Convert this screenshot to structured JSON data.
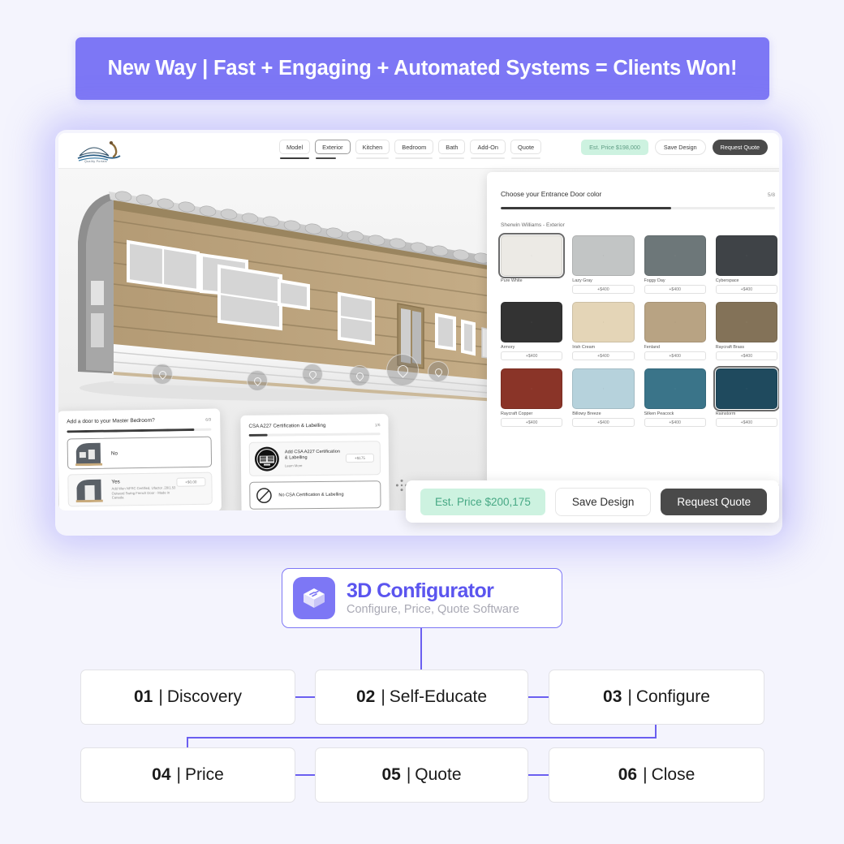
{
  "theme": {
    "page_bg": "#f4f4fd",
    "accent": "#7d77f5",
    "accent_dark": "#5b55ef",
    "price_green_bg": "#cdf2e0",
    "price_green_fg": "#46a884"
  },
  "banner": {
    "text": "New Way | Fast + Engaging + Automated Systems = Clients Won!"
  },
  "app": {
    "logo": {
      "caption": "Quality Portals"
    },
    "tabs": [
      {
        "label": "Model",
        "state": "done"
      },
      {
        "label": "Exterior",
        "state": "selected"
      },
      {
        "label": "Kitchen",
        "state": "idle"
      },
      {
        "label": "Bedroom",
        "state": "idle"
      },
      {
        "label": "Bath",
        "state": "idle"
      },
      {
        "label": "Add-On",
        "state": "idle"
      },
      {
        "label": "Quote",
        "state": "idle"
      }
    ],
    "topbar": {
      "price_label": "Est. Price $198,000",
      "save_label": "Save Design",
      "quote_label": "Request Quote"
    },
    "color_panel": {
      "title": "Choose your Entrance Door color",
      "step": "5/8",
      "progress_percent": 62,
      "brand_line": "Sherwin Williams - Exterior",
      "swatches": [
        {
          "name": "Pure White",
          "hex": "#eceae5",
          "price": "",
          "selected": true
        },
        {
          "name": "Lazy Gray",
          "hex": "#c2c5c5",
          "price": "+$400",
          "selected": false
        },
        {
          "name": "Foggy Day",
          "hex": "#6d7779",
          "price": "+$400",
          "selected": false
        },
        {
          "name": "Cyberspace",
          "hex": "#3f4347",
          "price": "+$400",
          "selected": false
        },
        {
          "name": "Armory",
          "hex": "#333333",
          "price": "+$400",
          "selected": false
        },
        {
          "name": "Irish Cream",
          "hex": "#e4d5b7",
          "price": "+$400",
          "selected": false
        },
        {
          "name": "Fenland",
          "hex": "#b8a383",
          "price": "+$400",
          "selected": false
        },
        {
          "name": "Raycraft Brass",
          "hex": "#837258",
          "price": "+$400",
          "selected": false
        },
        {
          "name": "Raycraft Copper",
          "hex": "#8a3428",
          "price": "+$400",
          "selected": false
        },
        {
          "name": "Billowy Breeze",
          "hex": "#b6d2dc",
          "price": "+$400",
          "selected": false
        },
        {
          "name": "Silken Peacock",
          "hex": "#3a7489",
          "price": "+$400",
          "selected": false
        },
        {
          "name": "Rainstorm",
          "hex": "#1f4a5e",
          "price": "+$400",
          "selected": true
        }
      ]
    },
    "door_panel": {
      "title": "Add a door to your Master Bedroom?",
      "step": "6/9",
      "progress_percent": 88,
      "options": [
        {
          "label": "No",
          "desc": "",
          "price": "",
          "selected": true
        },
        {
          "label": "Yes",
          "desc": "Add Wen NFRC Certified, Ufactor .28/1.53 Outward Swing French Door - Made in Canada",
          "price": "+$0.00",
          "selected": false
        }
      ]
    },
    "csa_panel": {
      "title": "CSA A227 Certification & Labelling",
      "step": "1/6",
      "progress_percent": 14,
      "options": [
        {
          "label": "Add CSA A227 Certification & Labelling",
          "desc": "Learn More",
          "price": "+$175",
          "selected": false
        },
        {
          "label": "No CSA Certification & Labelling",
          "desc": "",
          "price": "",
          "selected": true
        }
      ]
    },
    "bottom_bar": {
      "price_label": "Est. Price $200,175",
      "save_label": "Save Design",
      "quote_label": "Request Quote"
    }
  },
  "badge": {
    "title": "3D Configurator",
    "subtitle": "Configure, Price, Quote Software"
  },
  "flow": {
    "steps": [
      {
        "num": "01",
        "sep": "|",
        "label": "Discovery"
      },
      {
        "num": "02",
        "sep": "|",
        "label": "Self-Educate"
      },
      {
        "num": "03",
        "sep": "|",
        "label": "Configure"
      },
      {
        "num": "04",
        "sep": "|",
        "label": "Price"
      },
      {
        "num": "05",
        "sep": "|",
        "label": "Quote"
      },
      {
        "num": "06",
        "sep": "|",
        "label": "Close"
      }
    ]
  }
}
